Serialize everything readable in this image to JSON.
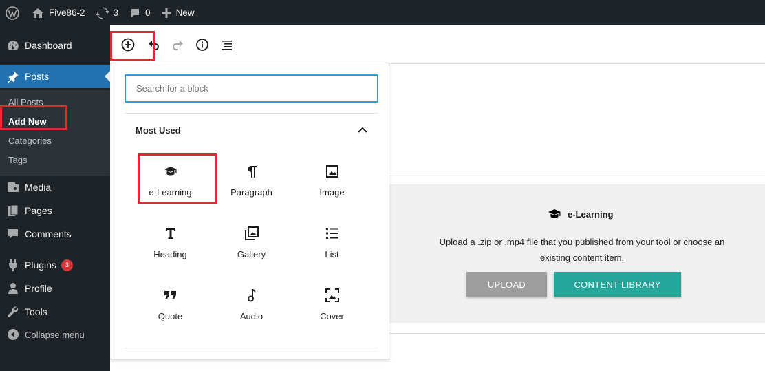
{
  "admin_bar": {
    "site_name": "Five86-2",
    "updates_count": "3",
    "comments_count": "0",
    "new_label": "New"
  },
  "sidebar": {
    "dashboard": "Dashboard",
    "posts": "Posts",
    "submenu": [
      "All Posts",
      "Add New",
      "Categories",
      "Tags"
    ],
    "media": "Media",
    "pages": "Pages",
    "comments": "Comments",
    "plugins": "Plugins",
    "plugins_badge": "3",
    "profile": "Profile",
    "tools": "Tools",
    "collapse": "Collapse menu"
  },
  "inserter": {
    "search_placeholder": "Search for a block",
    "category": "Most Used",
    "blocks": [
      "e-Learning",
      "Paragraph",
      "Image",
      "Heading",
      "Gallery",
      "List",
      "Quote",
      "Audio",
      "Cover"
    ]
  },
  "elearning_block": {
    "title": "e-Learning",
    "description": "Upload a .zip or .mp4 file that you published from your tool or choose an existing content item.",
    "upload_label": "UPLOAD",
    "library_label": "CONTENT LIBRARY"
  },
  "colors": {
    "admin_dark": "#1d2327",
    "accent_blue": "#2271b1",
    "highlight_red": "#e3262f",
    "library_teal": "#26a69a"
  }
}
